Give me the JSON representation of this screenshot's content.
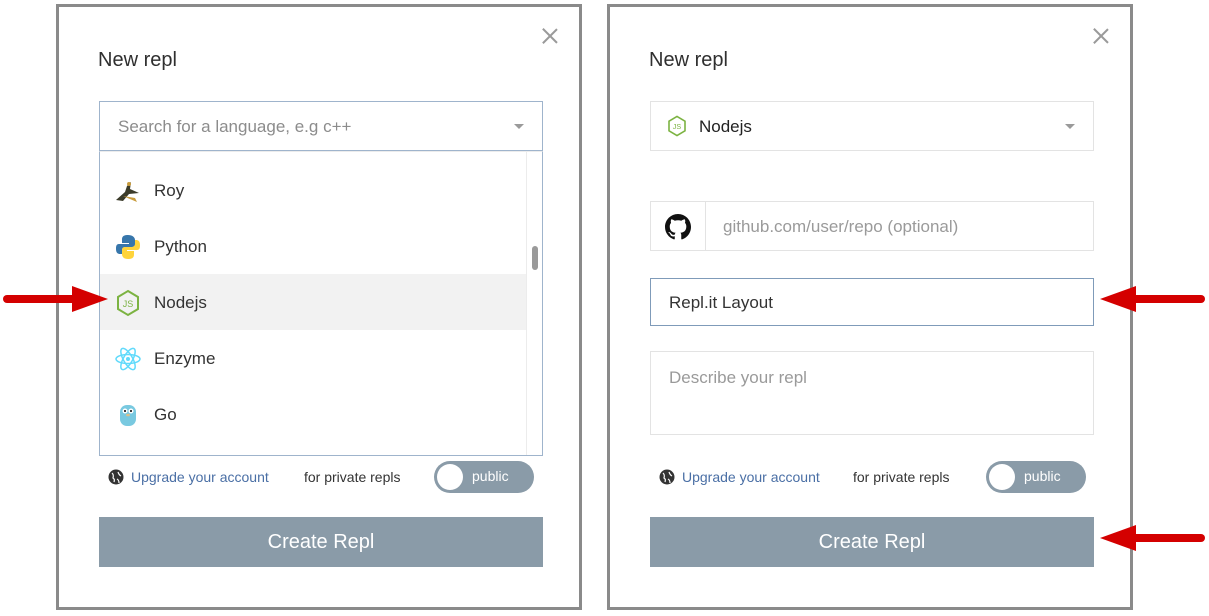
{
  "left_panel": {
    "title": "New repl",
    "search_placeholder": "Search for a language, e.g c++",
    "options": [
      {
        "label": "Roy",
        "icon": "roy-icon"
      },
      {
        "label": "Python",
        "icon": "python-icon"
      },
      {
        "label": "Nodejs",
        "icon": "nodejs-icon"
      },
      {
        "label": "Enzyme",
        "icon": "enzyme-icon"
      },
      {
        "label": "Go",
        "icon": "go-icon"
      }
    ],
    "hovered_option": "Nodejs",
    "upgrade_link": "Upgrade your account",
    "private_text": "for private repls",
    "toggle_label": "public",
    "create_button": "Create Repl"
  },
  "right_panel": {
    "title": "New repl",
    "selected_language": "Nodejs",
    "github_placeholder": "github.com/user/repo (optional)",
    "repl_name": "Repl.it Layout",
    "description_placeholder": "Describe your repl",
    "upgrade_link": "Upgrade your account",
    "private_text": "for private repls",
    "toggle_label": "public",
    "create_button": "Create Repl"
  },
  "colors": {
    "accent_button": "#8a9ba8",
    "link": "#4a6fa5",
    "annotation_arrow": "#d40000",
    "nodejs_green": "#7cb342"
  }
}
